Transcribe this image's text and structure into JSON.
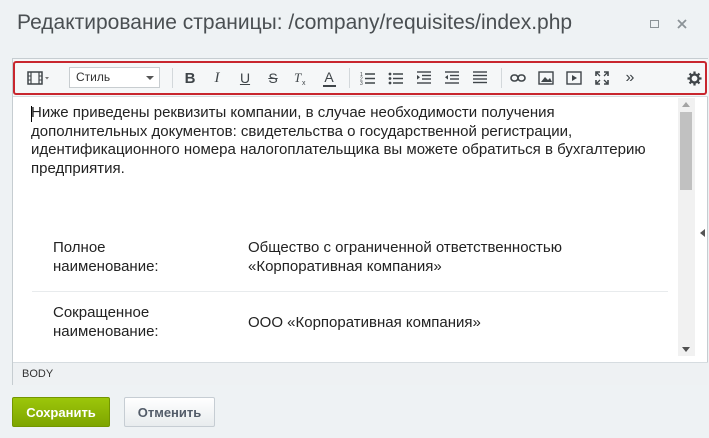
{
  "dialog": {
    "title": "Редактирование страницы: /company/requisites/index.php"
  },
  "toolbar": {
    "style_select": "Стиль",
    "bold_glyph": "B",
    "italic_glyph": "I",
    "underline_glyph": "U",
    "strike_glyph": "S",
    "font_color_glyph": "A",
    "more_glyph": "»"
  },
  "content": {
    "paragraph": "Ниже приведены реквизиты компании, в случае необходимости получения дополнительных документов: свидетельства о государственной регистрации, идентификационного номера налогоплательщика вы можете обратиться в бухгалтерию предприятия.",
    "rows": [
      {
        "label": "Полное наименование:",
        "value": "Общество с ограниченной ответственностью «Корпоративная компания»"
      },
      {
        "label": "Сокращенное наименование:",
        "value": "ООО «Корпоративная компания»"
      }
    ]
  },
  "statusbar": {
    "path": "BODY"
  },
  "buttons": {
    "save": "Сохранить",
    "cancel": "Отменить"
  },
  "colors": {
    "accent_save": "#86ad00",
    "highlight": "#c8262e",
    "title_text": "#4a4f52",
    "dialog_bg": "#eef2f4"
  },
  "icons": {
    "view": "film-strip-icon",
    "maximize": "maximize-icon",
    "close": "close-icon",
    "settings": "gear-icon"
  }
}
